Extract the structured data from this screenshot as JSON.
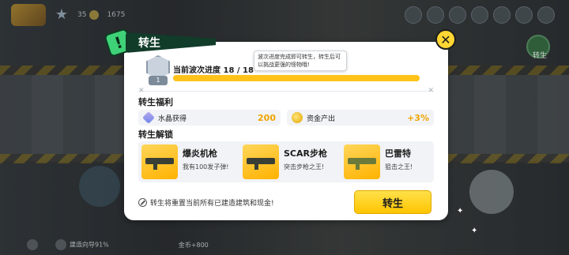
{
  "background": {
    "stats": [
      "35",
      "1675"
    ],
    "right_label": "转生",
    "bottom_items": [
      "",
      "建造向导91%"
    ],
    "bottom_center": "金币+800"
  },
  "dialog": {
    "title": "转生",
    "close_icon": "close-icon",
    "progress": {
      "label": "当前波次进度 18 / 18",
      "level": "1",
      "fraction": 1.0
    },
    "tooltip": "波次进度完成即可转生，转生后可以挑战更强的怪物哦!",
    "benefits_title": "转生福利",
    "benefits": [
      {
        "label": "水晶获得",
        "value": "200",
        "icon": "crystal-icon"
      },
      {
        "label": "资金产出",
        "value": "+3%",
        "icon": "coin-icon"
      }
    ],
    "unlock_title": "转生解锁",
    "weapons": [
      {
        "name": "爆炎机枪",
        "desc": "我有100发子弹!"
      },
      {
        "name": "SCAR步枪",
        "desc": "突击步枪之王!"
      },
      {
        "name": "巴雷特",
        "desc": "狙击之王!"
      }
    ],
    "footer_note": "转生将重置当前所有已建造建筑和现金!",
    "rebirth_button": "转生"
  },
  "colors": {
    "accent_yellow": "#ffc21a",
    "header_green": "#113c2a",
    "bang_green": "#3fd178"
  }
}
